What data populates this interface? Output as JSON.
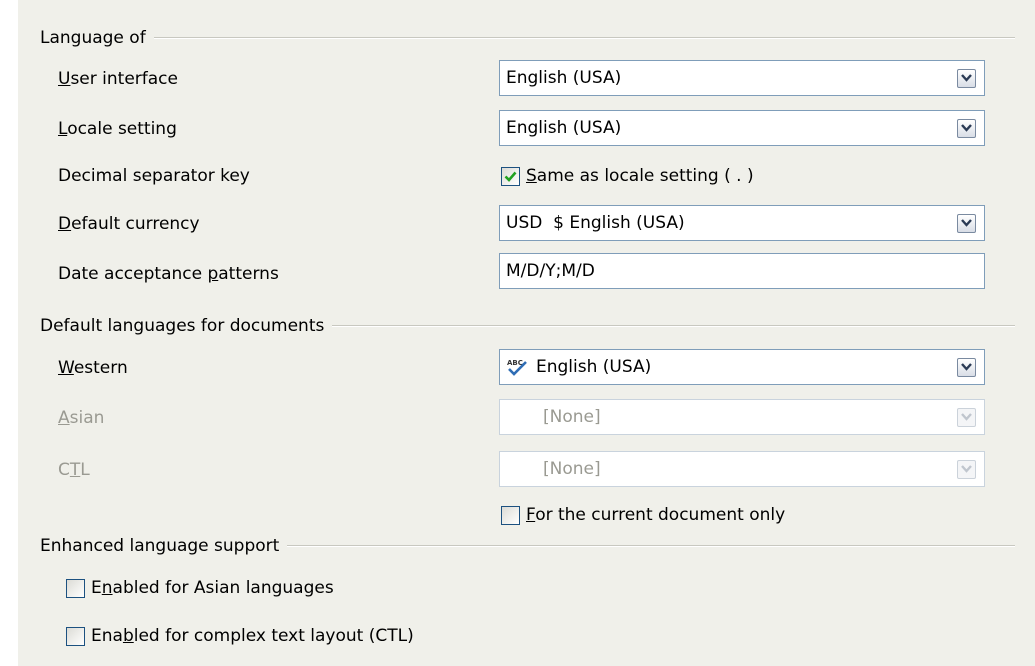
{
  "language_of": {
    "title": "Language of",
    "user_interface": {
      "label_u": "U",
      "label_rest": "ser interface",
      "value": "English (USA)"
    },
    "locale_setting": {
      "label_u": "L",
      "label_rest": "ocale setting",
      "value": "English (USA)"
    },
    "decimal_separator": {
      "label": "Decimal separator key",
      "check_u": "S",
      "check_rest": "ame as locale setting ( . )",
      "checked": true
    },
    "default_currency": {
      "label_u": "D",
      "label_rest": "efault currency",
      "value": "USD  $ English (USA)"
    },
    "date_patterns": {
      "label_pre": "Date acceptance ",
      "label_u": "p",
      "label_post": "atterns",
      "value": "M/D/Y;M/D"
    }
  },
  "default_languages": {
    "title": "Default languages for documents",
    "western": {
      "label_u": "W",
      "label_rest": "estern",
      "value": "English (USA)"
    },
    "asian": {
      "label_u": "A",
      "label_rest": "sian",
      "value": "[None]"
    },
    "ctl": {
      "label_pre": "C",
      "label_u": "T",
      "label_post": "L",
      "value": "[None]"
    },
    "current_doc_only": {
      "label_u": "F",
      "label_rest": "or the current document only",
      "checked": false
    }
  },
  "enhanced": {
    "title": "Enhanced language support",
    "asian": {
      "label_pre": "E",
      "label_u": "n",
      "label_post": "abled for Asian languages",
      "checked": false
    },
    "ctl": {
      "label_pre": "Ena",
      "label_u": "b",
      "label_post": "led for complex text layout (CTL)",
      "checked": false
    }
  },
  "colors": {
    "panel": "#f0f0ea",
    "check": "#21a121",
    "border": "#7f9db9"
  },
  "icons": {
    "dropdown": "chevron-down-icon",
    "spell": "spellcheck-abc-icon",
    "check": "checkmark-icon"
  }
}
